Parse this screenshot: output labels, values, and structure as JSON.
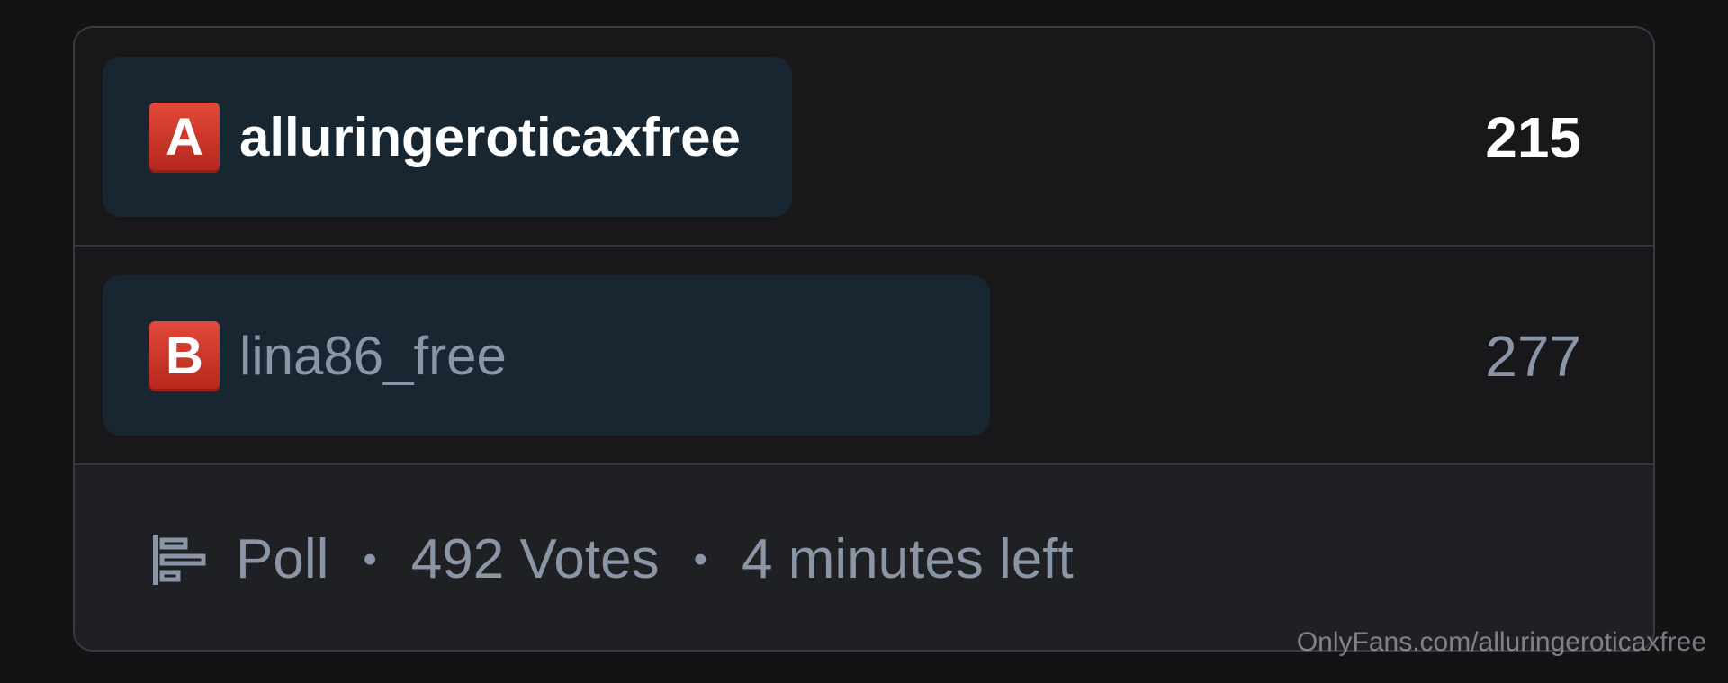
{
  "poll": {
    "options": [
      {
        "letter": "A",
        "label": "alluringeroticaxfree",
        "votes": "215",
        "share": 0.437,
        "selected": true
      },
      {
        "letter": "B",
        "label": "lina86_free",
        "votes": "277",
        "share": 0.563,
        "selected": false
      }
    ],
    "footer": {
      "icon": "poll-icon",
      "type_label": "Poll",
      "votes_label": "492 Votes",
      "time_label": "4 minutes left",
      "separator": "•"
    }
  },
  "watermark": "OnlyFans.com/alluringeroticaxfree",
  "colors": {
    "bar": "#172630",
    "badge": "#d6362b",
    "muted_text": "#8a95a6",
    "card_border": "#3a3b3f"
  }
}
